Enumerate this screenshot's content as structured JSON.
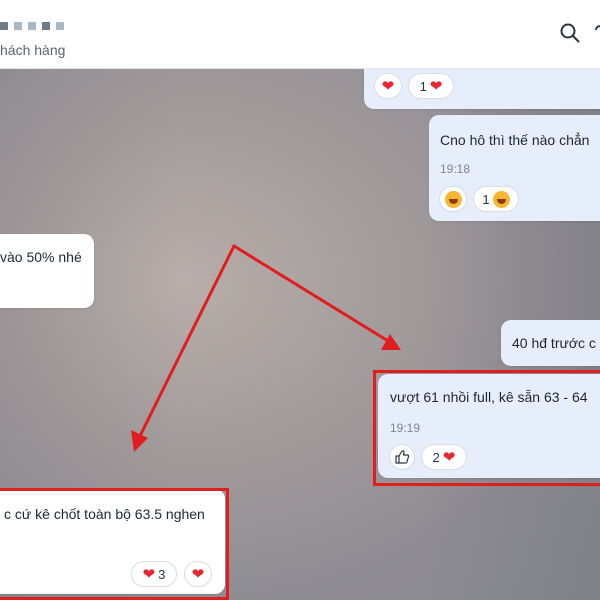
{
  "header": {
    "subtitle": "hách hàng",
    "icons": [
      "search-icon",
      "heart-icon"
    ]
  },
  "messages": [
    {
      "id": "m1",
      "text": "",
      "reaction": {
        "count": "1"
      }
    },
    {
      "id": "m2",
      "text": "Cno hô thì thế nào chẳn",
      "time": "19:18",
      "reaction": {
        "count": "1"
      }
    },
    {
      "id": "m3",
      "text": "vào 50% nhé"
    },
    {
      "id": "m4",
      "text": "40 hđ trước c"
    },
    {
      "id": "m5",
      "text": "vượt 61 nhồi full, kê sẵn 63 - 64",
      "time": "19:19",
      "reaction": {
        "count": "2"
      }
    },
    {
      "id": "m6",
      "text": "c cứ kê chốt toàn bộ 63.5 nghen",
      "reaction": {
        "count": "3"
      }
    }
  ],
  "colors": {
    "bubble_blue": "#e6eefc",
    "bubble_white": "#ffffff",
    "highlight_red": "#e21d1d",
    "heart_red": "#e8262f"
  }
}
